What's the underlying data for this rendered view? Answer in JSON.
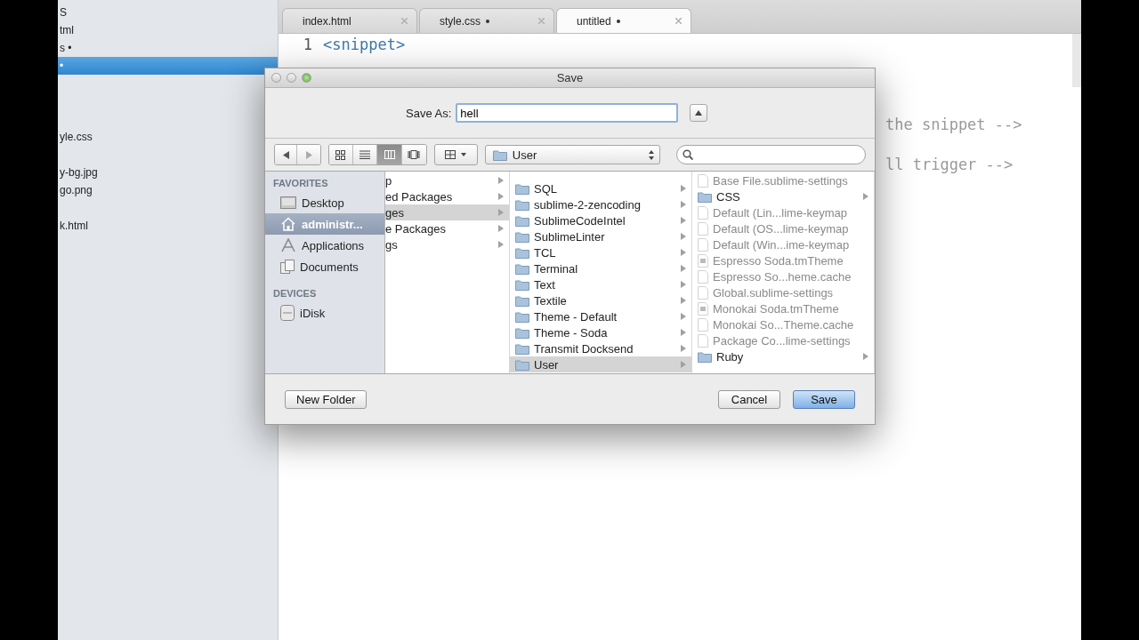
{
  "sidebar": {
    "items": [
      {
        "label": "S",
        "selected": false
      },
      {
        "label": "tml",
        "selected": false
      },
      {
        "label": "s •",
        "selected": false
      },
      {
        "label": "•",
        "selected": true
      },
      {
        "label": "yle.css",
        "selected": false
      },
      {
        "label": "y-bg.jpg",
        "selected": false
      },
      {
        "label": "go.png",
        "selected": false
      },
      {
        "label": "k.html",
        "selected": false
      }
    ]
  },
  "tabs": [
    {
      "label": "index.html",
      "modified": false,
      "selected": false
    },
    {
      "label": "style.css",
      "modified": true,
      "selected": false
    },
    {
      "label": "untitled",
      "modified": true,
      "selected": true
    }
  ],
  "editor": {
    "lines": [
      {
        "kind": "code",
        "number": "1",
        "tokens": [
          {
            "text": "<snippet>",
            "color": "#3f78a8"
          }
        ]
      },
      {
        "kind": "fragment",
        "tokens": [
          {
            "text": "the snippet -->",
            "color": "#9a9a9a"
          }
        ]
      },
      {
        "kind": "fragment",
        "tokens": [
          {
            "text": "ll trigger -->",
            "color": "#9a9a9a"
          }
        ]
      }
    ]
  },
  "dialog": {
    "title": "Save",
    "save_as": {
      "label": "Save As:",
      "value": "hell"
    },
    "view_modes": [
      {
        "kind": "icons",
        "selected": false
      },
      {
        "kind": "list",
        "selected": false
      },
      {
        "kind": "columns",
        "selected": true
      },
      {
        "kind": "coverflow",
        "selected": false
      }
    ],
    "path_popup": "User",
    "sidebar": [
      {
        "heading": "FAVORITES",
        "items": [
          {
            "label": "Desktop",
            "kind": "desktop",
            "selected": false
          },
          {
            "label": "administr...",
            "kind": "home",
            "selected": true
          },
          {
            "label": "Applications",
            "kind": "apps",
            "selected": false
          },
          {
            "label": "Documents",
            "kind": "documents",
            "selected": false
          }
        ]
      },
      {
        "heading": "DEVICES",
        "items": [
          {
            "label": "iDisk",
            "kind": "disk",
            "selected": false
          }
        ]
      }
    ],
    "columns": [
      {
        "clipped": true,
        "items": [
          {
            "label": "p",
            "kind": "folder",
            "selected": false
          },
          {
            "label": "ed Packages",
            "kind": "folder",
            "selected": false
          },
          {
            "label": "ges",
            "kind": "folder",
            "selected": true
          },
          {
            "label": "e Packages",
            "kind": "folder",
            "selected": false
          },
          {
            "label": "gs",
            "kind": "folder",
            "selected": false
          }
        ]
      },
      {
        "clipped": false,
        "items": [
          {
            "label": "SQL",
            "kind": "folder",
            "selected": false
          },
          {
            "label": "sublime-2-zencoding",
            "kind": "folder",
            "selected": false
          },
          {
            "label": "SublimeCodeIntel",
            "kind": "folder",
            "selected": false
          },
          {
            "label": "SublimeLinter",
            "kind": "folder",
            "selected": false
          },
          {
            "label": "TCL",
            "kind": "folder",
            "selected": false
          },
          {
            "label": "Terminal",
            "kind": "folder",
            "selected": false
          },
          {
            "label": "Text",
            "kind": "folder",
            "selected": false
          },
          {
            "label": "Textile",
            "kind": "folder",
            "selected": false
          },
          {
            "label": "Theme - Default",
            "kind": "folder",
            "selected": false
          },
          {
            "label": "Theme - Soda",
            "kind": "folder",
            "selected": false
          },
          {
            "label": "Transmit Docksend",
            "kind": "folder",
            "selected": false
          },
          {
            "label": "User",
            "kind": "folder",
            "selected": true
          }
        ]
      },
      {
        "clipped": false,
        "items": [
          {
            "label": "Base File.sublime-settings",
            "kind": "file",
            "selected": false
          },
          {
            "label": "CSS",
            "kind": "folder",
            "selected": false
          },
          {
            "label": "Default (Lin...lime-keymap",
            "kind": "file",
            "selected": false
          },
          {
            "label": "Default (OS...lime-keymap",
            "kind": "file",
            "selected": false
          },
          {
            "label": "Default (Win...ime-keymap",
            "kind": "file",
            "selected": false
          },
          {
            "label": "Espresso Soda.tmTheme",
            "kind": "theme",
            "selected": false
          },
          {
            "label": "Espresso So...heme.cache",
            "kind": "file",
            "selected": false
          },
          {
            "label": "Global.sublime-settings",
            "kind": "file",
            "selected": false
          },
          {
            "label": "Monokai Soda.tmTheme",
            "kind": "theme",
            "selected": false
          },
          {
            "label": "Monokai So...Theme.cache",
            "kind": "file",
            "selected": false
          },
          {
            "label": "Package Co...lime-settings",
            "kind": "file",
            "selected": false
          },
          {
            "label": "Ruby",
            "kind": "folder",
            "selected": false
          }
        ]
      }
    ],
    "buttons": [
      {
        "label": "New Folder",
        "kind": "plain"
      },
      {
        "label": "Cancel",
        "kind": "plain"
      },
      {
        "label": "Save",
        "kind": "default"
      }
    ]
  }
}
